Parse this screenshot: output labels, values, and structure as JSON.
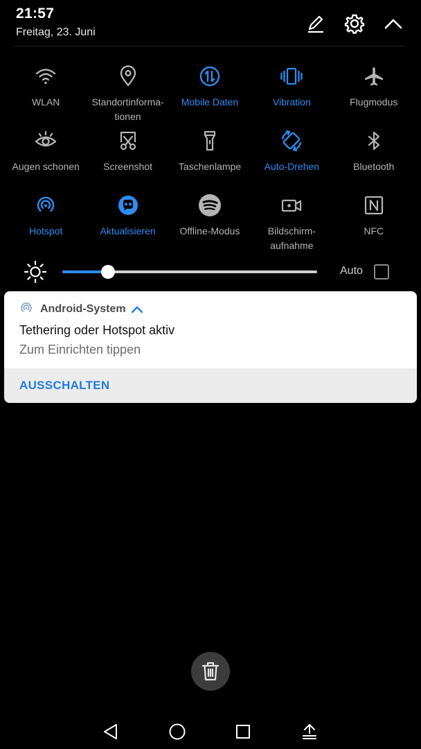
{
  "status": {
    "time": "21:57",
    "date": "Freitag, 23. Juni"
  },
  "header_icons": [
    "edit-icon",
    "settings-gear-icon",
    "collapse-chevron-icon"
  ],
  "colors": {
    "active": "#2f8cf0",
    "inactive": "#b4b4b4",
    "background": "#000000",
    "action": "#1e7be0"
  },
  "tiles": {
    "wlan": {
      "label": "WLAN",
      "icon": "wifi-icon",
      "active": false
    },
    "location": {
      "label": "Standortinforma-\ntionen",
      "icon": "location-pin-icon",
      "active": false
    },
    "mobile_data": {
      "label": "Mobile Daten",
      "icon": "mobile-data-icon",
      "active": true
    },
    "vibration": {
      "label": "Vibration",
      "icon": "vibration-icon",
      "active": true
    },
    "airplane": {
      "label": "Flugmodus",
      "icon": "airplane-icon",
      "active": false
    },
    "eye_comfort": {
      "label": "Augen schonen",
      "icon": "eye-icon",
      "active": false
    },
    "screenshot": {
      "label": "Screenshot",
      "icon": "screenshot-scissors-icon",
      "active": false
    },
    "flashlight": {
      "label": "Taschenlampe",
      "icon": "flashlight-icon",
      "active": false
    },
    "auto_rotate": {
      "label": "Auto-Drehen",
      "icon": "auto-rotate-icon",
      "active": true
    },
    "bluetooth": {
      "label": "Bluetooth",
      "icon": "bluetooth-icon",
      "active": false
    },
    "hotspot": {
      "label": "Hotspot",
      "icon": "hotspot-icon",
      "active": true
    },
    "update": {
      "label": "Aktualisieren",
      "icon": "update-app-icon",
      "active": true
    },
    "offline": {
      "label": "Offline-Modus",
      "icon": "spotify-icon",
      "active": false
    },
    "screen_record": {
      "label": "Bildschirm-\naufnahme",
      "icon": "screen-record-icon",
      "active": false
    },
    "nfc": {
      "label": "NFC",
      "icon": "nfc-icon",
      "active": false
    }
  },
  "brightness": {
    "level": 0.18,
    "auto_label": "Auto",
    "auto_checked": false
  },
  "notification": {
    "app": "Android-System",
    "title": "Tethering oder Hotspot aktiv",
    "text": "Zum Einrichten tippen",
    "action": "AUSSCHALTEN"
  },
  "navbar": [
    "back-icon",
    "home-icon",
    "recent-apps-icon",
    "notification-pull-icon"
  ]
}
